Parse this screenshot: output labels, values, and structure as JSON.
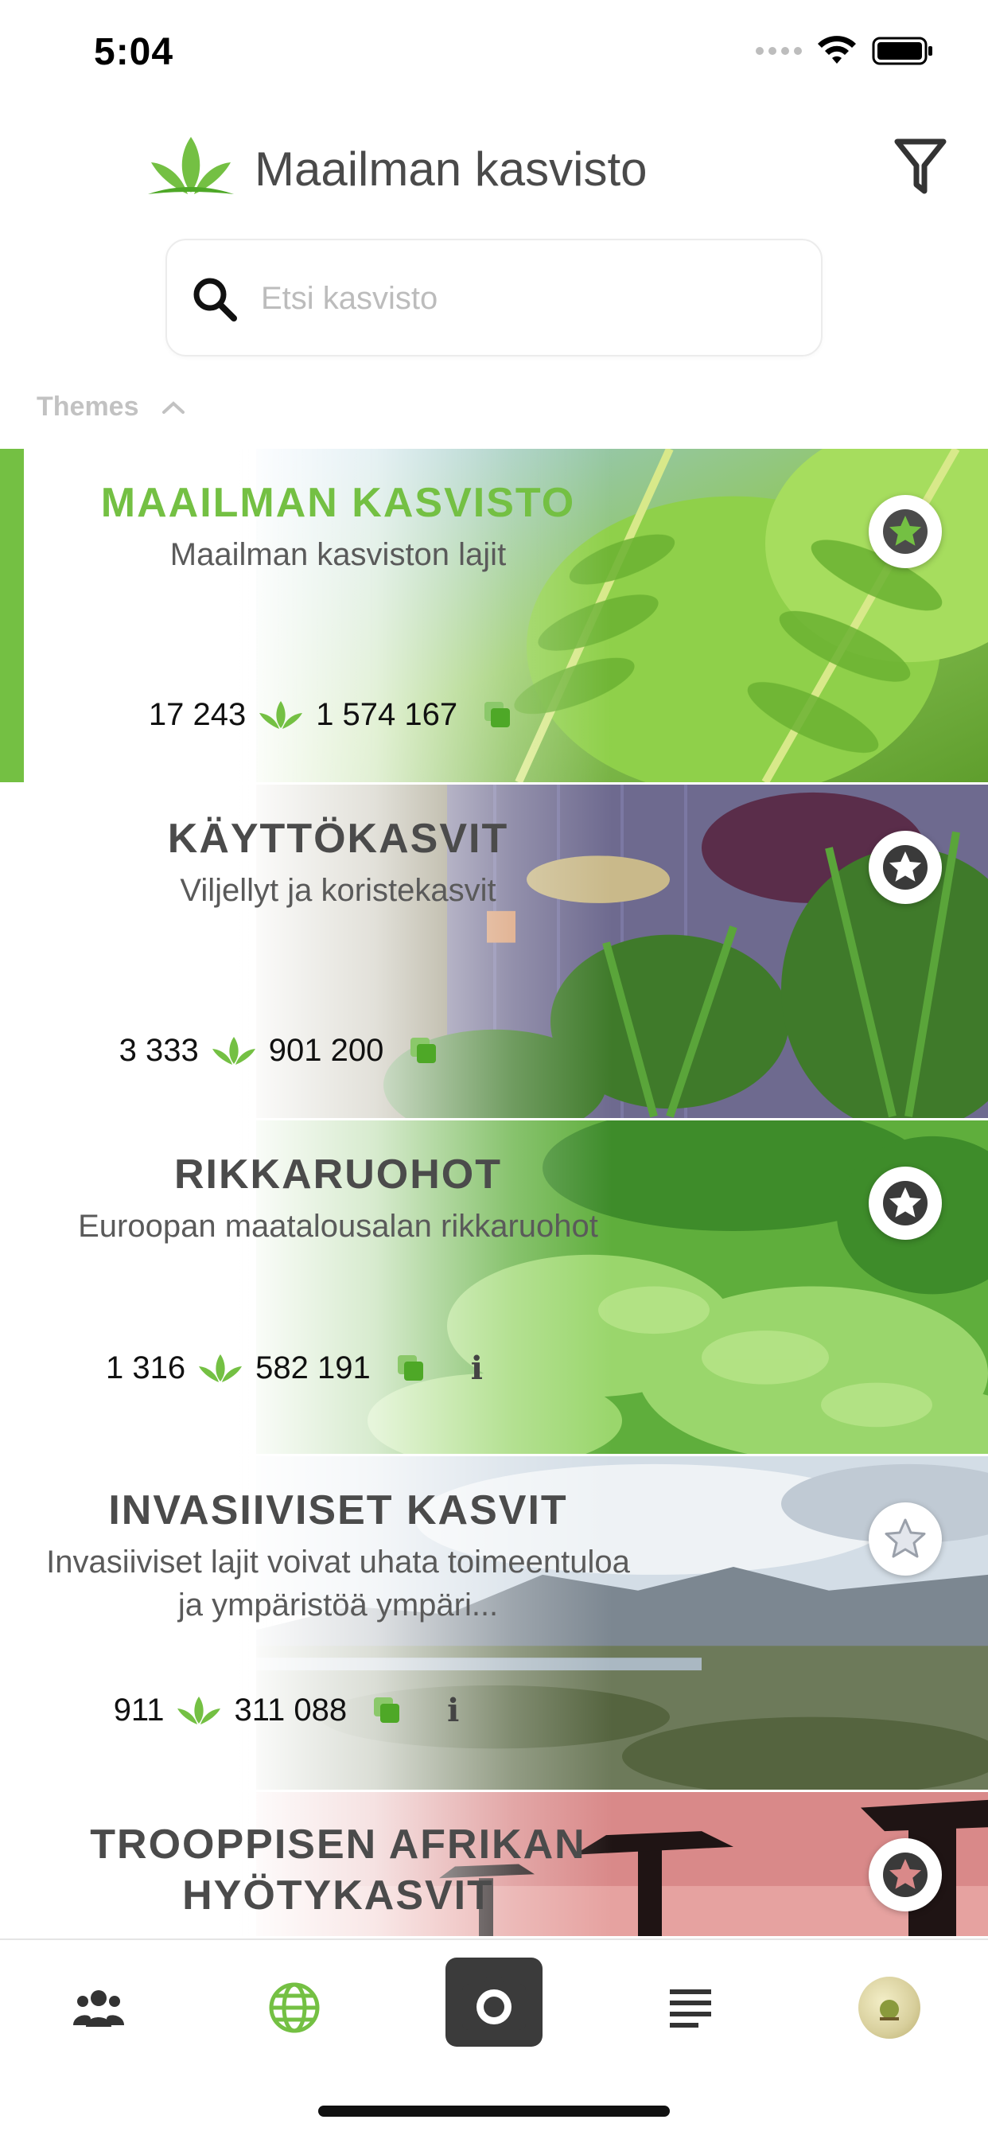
{
  "status_bar": {
    "time": "5:04"
  },
  "header": {
    "title": "Maailman kasvisto"
  },
  "search": {
    "placeholder": "Etsi kasvisto",
    "value": ""
  },
  "themes_section": {
    "label": "Themes"
  },
  "themes": [
    {
      "title": "MAAILMAN KASVISTO",
      "subtitle": "Maailman kasviston lajit",
      "species_count": "17 243",
      "image_count": "1 574 167",
      "active": true,
      "starred": true,
      "has_info": false
    },
    {
      "title": "KÄYTTÖKASVIT",
      "subtitle": "Viljellyt ja koristekasvit",
      "species_count": "3 333",
      "image_count": "901 200",
      "active": false,
      "starred": true,
      "has_info": false
    },
    {
      "title": "RIKKARUOHOT",
      "subtitle": "Euroopan maatalousalan rikkaruohot",
      "species_count": "1 316",
      "image_count": "582 191",
      "active": false,
      "starred": true,
      "has_info": true
    },
    {
      "title": "INVASIIVISET KASVIT",
      "subtitle": "Invasiiviset lajit voivat uhata toimeentuloa ja ympäristöä ympäri...",
      "species_count": "911",
      "image_count": "311 088",
      "active": false,
      "starred": false,
      "has_info": true
    },
    {
      "title": "TROOPPISEN AFRIKAN HYÖTYKASVIT",
      "subtitle": "",
      "species_count": "",
      "image_count": "",
      "active": false,
      "starred": true,
      "has_info": false
    }
  ],
  "tabbar": {
    "tabs": [
      "community-icon",
      "globe-icon",
      "camera-icon",
      "list-icon",
      "profile-avatar"
    ],
    "active": "globe-icon"
  },
  "colors": {
    "accent": "#74c043",
    "accent_dark": "#4ea827",
    "text": "#4b4b4b"
  }
}
